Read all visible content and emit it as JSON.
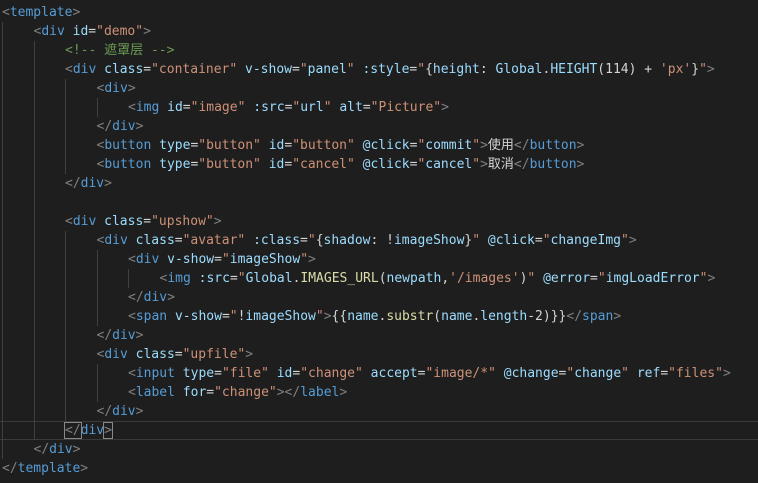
{
  "editor": {
    "language": "vue",
    "theme_colors": {
      "background": "#1e1e1e",
      "tag": "#569cd6",
      "punctuation": "#808080",
      "attribute": "#9cdcfe",
      "string": "#ce9178",
      "comment": "#6a9955",
      "text": "#d4d4d4",
      "function": "#dcdcaa"
    },
    "current_line": 23,
    "lines": [
      {
        "indent": 0,
        "tokens": [
          [
            "p",
            "<"
          ],
          [
            "t",
            "template"
          ],
          [
            "p",
            ">"
          ]
        ]
      },
      {
        "indent": 1,
        "tokens": [
          [
            "p",
            "<"
          ],
          [
            "t",
            "div"
          ],
          [
            "x",
            " "
          ],
          [
            "a",
            "id"
          ],
          [
            "x",
            "="
          ],
          [
            "s",
            "\"demo\""
          ],
          [
            "p",
            ">"
          ]
        ]
      },
      {
        "indent": 2,
        "tokens": [
          [
            "c",
            "<!-- 遮罩层 -->"
          ]
        ]
      },
      {
        "indent": 2,
        "tokens": [
          [
            "p",
            "<"
          ],
          [
            "t",
            "div"
          ],
          [
            "x",
            " "
          ],
          [
            "a",
            "class"
          ],
          [
            "x",
            "="
          ],
          [
            "s",
            "\"container\""
          ],
          [
            "x",
            " "
          ],
          [
            "a",
            "v-show"
          ],
          [
            "x",
            "="
          ],
          [
            "s",
            "\""
          ],
          [
            "a",
            "panel"
          ],
          [
            "s",
            "\""
          ],
          [
            "x",
            " "
          ],
          [
            "a",
            ":style"
          ],
          [
            "x",
            "="
          ],
          [
            "s",
            "\""
          ],
          [
            "x",
            "{"
          ],
          [
            "a",
            "height"
          ],
          [
            "x",
            ": "
          ],
          [
            "a",
            "Global"
          ],
          [
            "x",
            "."
          ],
          [
            "a",
            "HEIGHT"
          ],
          [
            "x",
            "("
          ],
          [
            "x",
            "114"
          ],
          [
            "x",
            ") + "
          ],
          [
            "s",
            "'px'"
          ],
          [
            "x",
            "}"
          ],
          [
            "s",
            "\""
          ],
          [
            "p",
            ">"
          ]
        ]
      },
      {
        "indent": 3,
        "tokens": [
          [
            "p",
            "<"
          ],
          [
            "t",
            "div"
          ],
          [
            "p",
            ">"
          ]
        ]
      },
      {
        "indent": 4,
        "tokens": [
          [
            "p",
            "<"
          ],
          [
            "t",
            "img"
          ],
          [
            "x",
            " "
          ],
          [
            "a",
            "id"
          ],
          [
            "x",
            "="
          ],
          [
            "s",
            "\"image\""
          ],
          [
            "x",
            " "
          ],
          [
            "a",
            ":src"
          ],
          [
            "x",
            "="
          ],
          [
            "s",
            "\""
          ],
          [
            "a",
            "url"
          ],
          [
            "s",
            "\""
          ],
          [
            "x",
            " "
          ],
          [
            "a",
            "alt"
          ],
          [
            "x",
            "="
          ],
          [
            "s",
            "\"Picture\""
          ],
          [
            "p",
            ">"
          ]
        ]
      },
      {
        "indent": 3,
        "tokens": [
          [
            "p",
            "</"
          ],
          [
            "t",
            "div"
          ],
          [
            "p",
            ">"
          ]
        ]
      },
      {
        "indent": 3,
        "tokens": [
          [
            "p",
            "<"
          ],
          [
            "t",
            "button"
          ],
          [
            "x",
            " "
          ],
          [
            "a",
            "type"
          ],
          [
            "x",
            "="
          ],
          [
            "s",
            "\"button\""
          ],
          [
            "x",
            " "
          ],
          [
            "a",
            "id"
          ],
          [
            "x",
            "="
          ],
          [
            "s",
            "\"button\""
          ],
          [
            "x",
            " "
          ],
          [
            "a",
            "@click"
          ],
          [
            "x",
            "="
          ],
          [
            "s",
            "\""
          ],
          [
            "a",
            "commit"
          ],
          [
            "s",
            "\""
          ],
          [
            "p",
            ">"
          ],
          [
            "x",
            "使用"
          ],
          [
            "p",
            "</"
          ],
          [
            "t",
            "button"
          ],
          [
            "p",
            ">"
          ]
        ]
      },
      {
        "indent": 3,
        "tokens": [
          [
            "p",
            "<"
          ],
          [
            "t",
            "button"
          ],
          [
            "x",
            " "
          ],
          [
            "a",
            "type"
          ],
          [
            "x",
            "="
          ],
          [
            "s",
            "\"button\""
          ],
          [
            "x",
            " "
          ],
          [
            "a",
            "id"
          ],
          [
            "x",
            "="
          ],
          [
            "s",
            "\"cancel\""
          ],
          [
            "x",
            " "
          ],
          [
            "a",
            "@click"
          ],
          [
            "x",
            "="
          ],
          [
            "s",
            "\""
          ],
          [
            "a",
            "cancel"
          ],
          [
            "s",
            "\""
          ],
          [
            "p",
            ">"
          ],
          [
            "x",
            "取消"
          ],
          [
            "p",
            "</"
          ],
          [
            "t",
            "button"
          ],
          [
            "p",
            ">"
          ]
        ]
      },
      {
        "indent": 2,
        "tokens": [
          [
            "p",
            "</"
          ],
          [
            "t",
            "div"
          ],
          [
            "p",
            ">"
          ]
        ]
      },
      {
        "indent": 2,
        "tokens": []
      },
      {
        "indent": 2,
        "tokens": [
          [
            "p",
            "<"
          ],
          [
            "t",
            "div"
          ],
          [
            "x",
            " "
          ],
          [
            "a",
            "class"
          ],
          [
            "x",
            "="
          ],
          [
            "s",
            "\"upshow\""
          ],
          [
            "p",
            ">"
          ]
        ]
      },
      {
        "indent": 3,
        "tokens": [
          [
            "p",
            "<"
          ],
          [
            "t",
            "div"
          ],
          [
            "x",
            " "
          ],
          [
            "a",
            "class"
          ],
          [
            "x",
            "="
          ],
          [
            "s",
            "\"avatar\""
          ],
          [
            "x",
            " "
          ],
          [
            "a",
            ":class"
          ],
          [
            "x",
            "="
          ],
          [
            "s",
            "\""
          ],
          [
            "x",
            "{"
          ],
          [
            "a",
            "shadow"
          ],
          [
            "x",
            ": !"
          ],
          [
            "a",
            "imageShow"
          ],
          [
            "x",
            "}"
          ],
          [
            "s",
            "\""
          ],
          [
            "x",
            " "
          ],
          [
            "a",
            "@click"
          ],
          [
            "x",
            "="
          ],
          [
            "s",
            "\""
          ],
          [
            "a",
            "changeImg"
          ],
          [
            "s",
            "\""
          ],
          [
            "p",
            ">"
          ]
        ]
      },
      {
        "indent": 4,
        "tokens": [
          [
            "p",
            "<"
          ],
          [
            "t",
            "div"
          ],
          [
            "x",
            " "
          ],
          [
            "a",
            "v-show"
          ],
          [
            "x",
            "="
          ],
          [
            "s",
            "\""
          ],
          [
            "a",
            "imageShow"
          ],
          [
            "s",
            "\""
          ],
          [
            "p",
            ">"
          ]
        ]
      },
      {
        "indent": 5,
        "tokens": [
          [
            "p",
            "<"
          ],
          [
            "t",
            "img"
          ],
          [
            "x",
            " "
          ],
          [
            "a",
            ":src"
          ],
          [
            "x",
            "="
          ],
          [
            "s",
            "\""
          ],
          [
            "a",
            "Global"
          ],
          [
            "x",
            "."
          ],
          [
            "f",
            "IMAGES_URL"
          ],
          [
            "x",
            "("
          ],
          [
            "a",
            "newpath"
          ],
          [
            "x",
            ","
          ],
          [
            "s",
            "'/images'"
          ],
          [
            "x",
            ")"
          ],
          [
            "s",
            "\""
          ],
          [
            "x",
            " "
          ],
          [
            "a",
            "@error"
          ],
          [
            "x",
            "="
          ],
          [
            "s",
            "\""
          ],
          [
            "a",
            "imgLoadError"
          ],
          [
            "s",
            "\""
          ],
          [
            "p",
            ">"
          ]
        ]
      },
      {
        "indent": 4,
        "tokens": [
          [
            "p",
            "</"
          ],
          [
            "t",
            "div"
          ],
          [
            "p",
            ">"
          ]
        ]
      },
      {
        "indent": 4,
        "tokens": [
          [
            "p",
            "<"
          ],
          [
            "t",
            "span"
          ],
          [
            "x",
            " "
          ],
          [
            "a",
            "v-show"
          ],
          [
            "x",
            "="
          ],
          [
            "s",
            "\""
          ],
          [
            "x",
            "!"
          ],
          [
            "a",
            "imageShow"
          ],
          [
            "s",
            "\""
          ],
          [
            "p",
            ">"
          ],
          [
            "x",
            "{{"
          ],
          [
            "a",
            "name"
          ],
          [
            "x",
            "."
          ],
          [
            "f",
            "substr"
          ],
          [
            "x",
            "("
          ],
          [
            "a",
            "name"
          ],
          [
            "x",
            "."
          ],
          [
            "a",
            "length"
          ],
          [
            "x",
            "-2)}}"
          ],
          [
            "p",
            "</"
          ],
          [
            "t",
            "span"
          ],
          [
            "p",
            ">"
          ]
        ]
      },
      {
        "indent": 3,
        "tokens": [
          [
            "p",
            "</"
          ],
          [
            "t",
            "div"
          ],
          [
            "p",
            ">"
          ]
        ]
      },
      {
        "indent": 3,
        "tokens": [
          [
            "p",
            "<"
          ],
          [
            "t",
            "div"
          ],
          [
            "x",
            " "
          ],
          [
            "a",
            "class"
          ],
          [
            "x",
            "="
          ],
          [
            "s",
            "\"upfile\""
          ],
          [
            "p",
            ">"
          ]
        ]
      },
      {
        "indent": 4,
        "tokens": [
          [
            "p",
            "<"
          ],
          [
            "t",
            "input"
          ],
          [
            "x",
            " "
          ],
          [
            "a",
            "type"
          ],
          [
            "x",
            "="
          ],
          [
            "s",
            "\"file\""
          ],
          [
            "x",
            " "
          ],
          [
            "a",
            "id"
          ],
          [
            "x",
            "="
          ],
          [
            "s",
            "\"change\""
          ],
          [
            "x",
            " "
          ],
          [
            "a",
            "accept"
          ],
          [
            "x",
            "="
          ],
          [
            "s",
            "\"image/*\""
          ],
          [
            "x",
            " "
          ],
          [
            "a",
            "@change"
          ],
          [
            "x",
            "="
          ],
          [
            "s",
            "\""
          ],
          [
            "a",
            "change"
          ],
          [
            "s",
            "\""
          ],
          [
            "x",
            " "
          ],
          [
            "a",
            "ref"
          ],
          [
            "x",
            "="
          ],
          [
            "s",
            "\"files\""
          ],
          [
            "p",
            ">"
          ]
        ]
      },
      {
        "indent": 4,
        "tokens": [
          [
            "p",
            "<"
          ],
          [
            "t",
            "label"
          ],
          [
            "x",
            " "
          ],
          [
            "a",
            "for"
          ],
          [
            "x",
            "="
          ],
          [
            "s",
            "\"change\""
          ],
          [
            "p",
            "></"
          ],
          [
            "t",
            "label"
          ],
          [
            "p",
            ">"
          ]
        ]
      },
      {
        "indent": 3,
        "tokens": [
          [
            "p",
            "</"
          ],
          [
            "t",
            "div"
          ],
          [
            "p",
            ">"
          ]
        ]
      },
      {
        "indent": 2,
        "tokens": [
          [
            "p br",
            "</"
          ],
          [
            "t",
            "div"
          ],
          [
            "p br",
            ">"
          ]
        ]
      },
      {
        "indent": 1,
        "tokens": [
          [
            "p",
            "</"
          ],
          [
            "t",
            "div"
          ],
          [
            "p",
            ">"
          ]
        ]
      },
      {
        "indent": 0,
        "tokens": [
          [
            "p",
            "</"
          ],
          [
            "t",
            "template"
          ],
          [
            "p",
            ">"
          ]
        ]
      }
    ]
  }
}
